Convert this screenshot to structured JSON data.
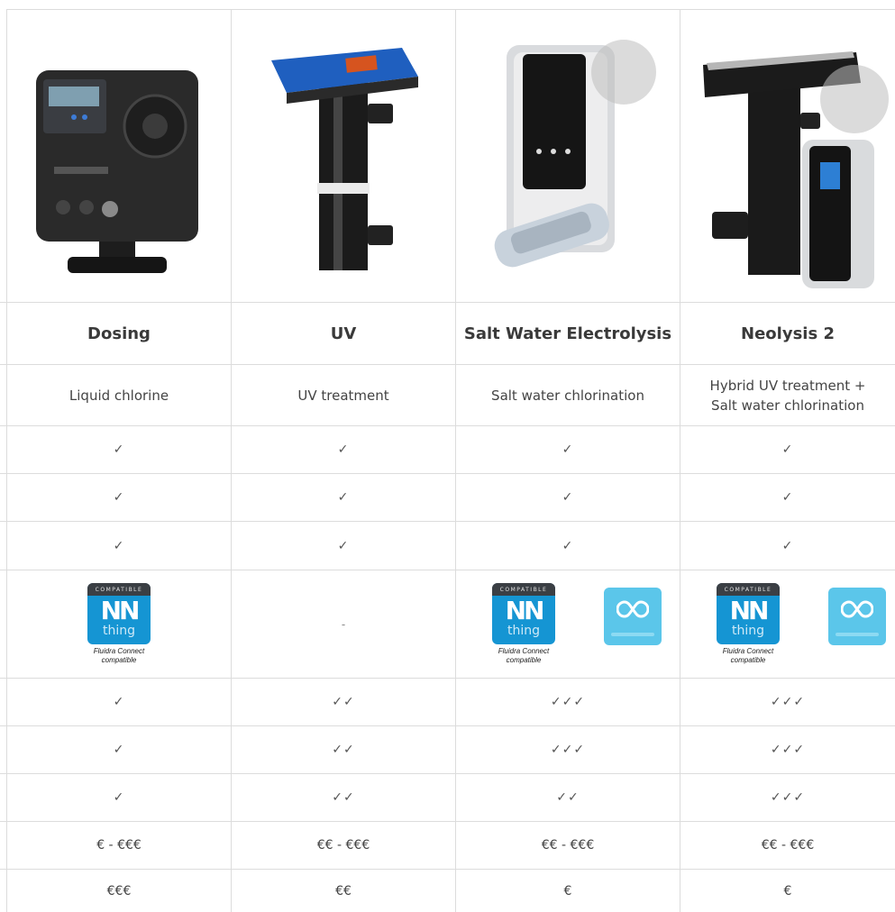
{
  "columns": [
    {
      "title": "Dosing",
      "description": "Liquid chlorine",
      "checks": [
        "✓",
        "✓",
        "✓"
      ],
      "connectivity": {
        "nn_badge": true,
        "cloud_badge": false,
        "caption": "Fluidra Connect compatible",
        "dash": ""
      },
      "ratings": [
        "✓",
        "✓",
        "✓"
      ],
      "price_purchase": "€ - €€€",
      "price_running": "€€€"
    },
    {
      "title": "UV",
      "description": "UV treatment",
      "checks": [
        "✓",
        "✓",
        "✓"
      ],
      "connectivity": {
        "nn_badge": false,
        "cloud_badge": false,
        "caption": "",
        "dash": "-"
      },
      "ratings": [
        "✓✓",
        "✓✓",
        "✓✓"
      ],
      "price_purchase": "€€ - €€€",
      "price_running": "€€"
    },
    {
      "title": "Salt Water Electrolysis",
      "description": "Salt water chlorination",
      "checks": [
        "✓",
        "✓",
        "✓"
      ],
      "connectivity": {
        "nn_badge": true,
        "cloud_badge": true,
        "caption": "Fluidra Connect compatible",
        "dash": ""
      },
      "ratings": [
        "✓✓✓",
        "✓✓✓",
        "✓✓"
      ],
      "price_purchase": "€€ - €€€",
      "price_running": "€"
    },
    {
      "title": "Neolysis 2",
      "description": "Hybrid UV treatment + Salt water chlorination",
      "checks": [
        "✓",
        "✓",
        "✓"
      ],
      "connectivity": {
        "nn_badge": true,
        "cloud_badge": true,
        "caption": "Fluidra Connect compatible",
        "dash": ""
      },
      "ratings": [
        "✓✓✓",
        "✓✓✓",
        "✓✓✓"
      ],
      "price_purchase": "€€ - €€€",
      "price_running": "€"
    }
  ],
  "badge": {
    "compatible_label": "COMPATIBLE",
    "nn_mark": "NN",
    "nn_word": "thing"
  },
  "colors": {
    "grid": "#dcdcdc",
    "badge_blue": "#1595d3",
    "badge_cloud": "#5bc6ea"
  }
}
